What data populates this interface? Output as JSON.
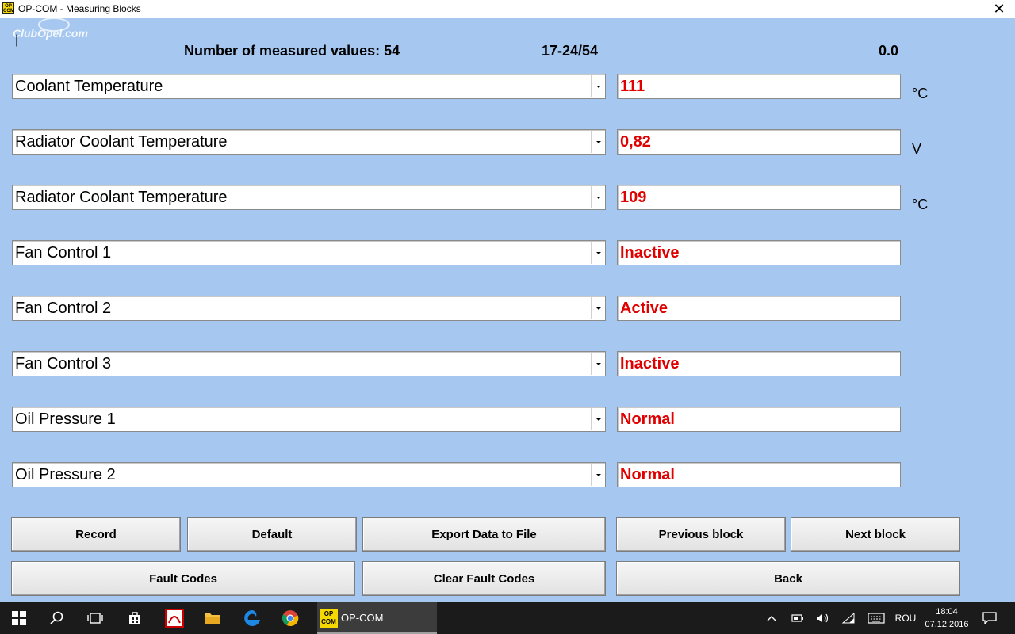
{
  "window": {
    "title": "OP-COM - Measuring Blocks",
    "icon_text": "OP COM",
    "close_glyph": "✕"
  },
  "watermark": "ClubOpel.com",
  "header": {
    "count_label": "Number of measured values: 54",
    "range": "17-24/54",
    "value": "0.0"
  },
  "rows": [
    {
      "name": "Coolant Temperature",
      "value": "111",
      "unit": "°C"
    },
    {
      "name": "Radiator Coolant Temperature",
      "value": "0,82",
      "unit": "V"
    },
    {
      "name": "Radiator Coolant Temperature",
      "value": "109",
      "unit": "°C"
    },
    {
      "name": "Fan Control 1",
      "value": "Inactive",
      "unit": ""
    },
    {
      "name": "Fan Control 2",
      "value": "Active",
      "unit": ""
    },
    {
      "name": "Fan Control 3",
      "value": "Inactive",
      "unit": ""
    },
    {
      "name": "Oil Pressure 1",
      "value": "Normal",
      "unit": ""
    },
    {
      "name": "Oil Pressure 2",
      "value": "Normal",
      "unit": ""
    }
  ],
  "buttons": {
    "record": "Record",
    "default": "Default",
    "export": "Export Data to File",
    "previous": "Previous block",
    "next": "Next block",
    "fault_codes": "Fault Codes",
    "clear_fault_codes": "Clear Fault Codes",
    "back": "Back"
  },
  "taskbar": {
    "active_app": "OP-COM",
    "active_icon_text": "OP COM",
    "language": "ROU",
    "time": "18:04",
    "date": "07.12.2016"
  },
  "colors": {
    "background": "#a6c8f0",
    "value_text": "#e00000",
    "taskbar": "#1b1b1b"
  }
}
